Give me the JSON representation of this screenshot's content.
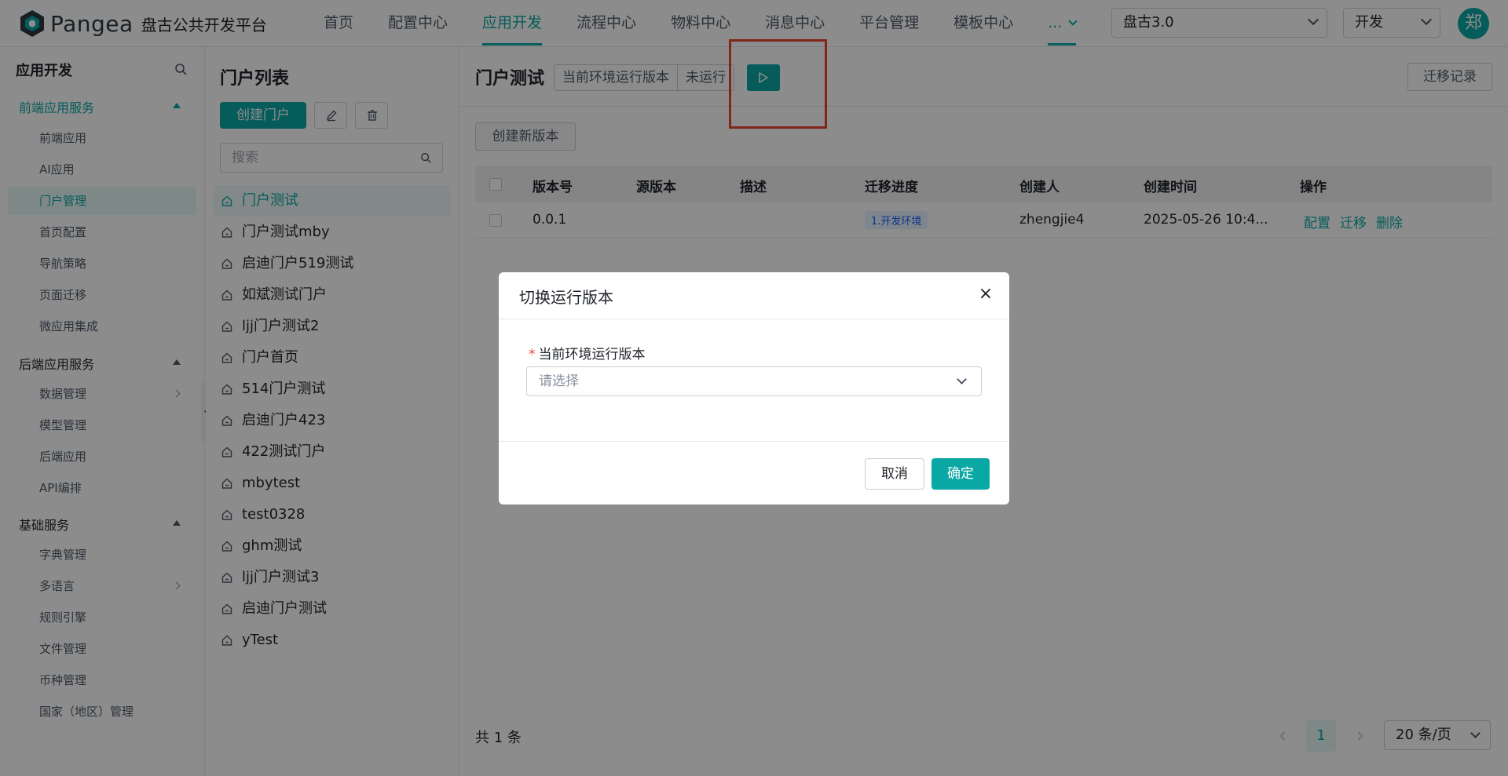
{
  "app": {
    "brand": "Pangea",
    "subtitle": "盘古公共开发平台"
  },
  "nav": {
    "items": [
      "首页",
      "配置中心",
      "应用开发",
      "流程中心",
      "物料中心",
      "消息中心",
      "平台管理",
      "模板中心"
    ],
    "more": "...",
    "active": "应用开发"
  },
  "header": {
    "project_select": "盘古3.0",
    "env_select": "开发",
    "avatar": "郑"
  },
  "sidebar": {
    "title": "应用开发",
    "groups": [
      {
        "label": "前端应用服务",
        "items": [
          "前端应用",
          "AI应用",
          "门户管理",
          "首页配置",
          "导航策略",
          "页面迁移",
          "微应用集成"
        ]
      },
      {
        "label": "后端应用服务",
        "items": [
          "数据管理",
          "模型管理",
          "后端应用",
          "API编排"
        ]
      },
      {
        "label": "基础服务",
        "items": [
          "字典管理",
          "多语言",
          "规则引擎",
          "文件管理",
          "币种管理",
          "国家（地区）管理"
        ]
      }
    ],
    "active_item": "门户管理"
  },
  "portal_list": {
    "title": "门户列表",
    "create_label": "创建门户",
    "search_placeholder": "搜索",
    "items": [
      "门户测试",
      "门户测试mby",
      "启迪门户519测试",
      "如斌测试门户",
      "ljj门户测试2",
      "门户首页",
      "514门户测试",
      "启迪门户423",
      "422测试门户",
      "mbytest",
      "test0328",
      "ghm测试",
      "ljj门户测试3",
      "启迪门户测试",
      "yTest"
    ],
    "active": "门户测试"
  },
  "main": {
    "title": "门户测试",
    "env_label": "当前环境运行版本",
    "status": "未运行",
    "migrate_record": "迁移记录",
    "new_version": "创建新版本",
    "columns": [
      "版本号",
      "源版本",
      "描述",
      "迁移进度",
      "创建人",
      "创建时间",
      "操作"
    ],
    "rows": [
      {
        "version": "0.0.1",
        "source": "",
        "desc": "",
        "progress": "1.开发环境",
        "creator": "zhengjie4",
        "created": "2025-05-26 10:4...",
        "ops": [
          "配置",
          "迁移",
          "删除"
        ]
      }
    ],
    "total": "共 1 条",
    "page": "1",
    "page_size": "20 条/页"
  },
  "modal": {
    "title": "切换运行版本",
    "close": "×",
    "field_label": "当前环境运行版本",
    "required_mark": "*",
    "placeholder": "请选择",
    "cancel": "取消",
    "ok": "确定"
  },
  "colors": {
    "accent": "#0aa8a4",
    "highlight": "#e8442f",
    "tag_text": "#1664ff"
  }
}
